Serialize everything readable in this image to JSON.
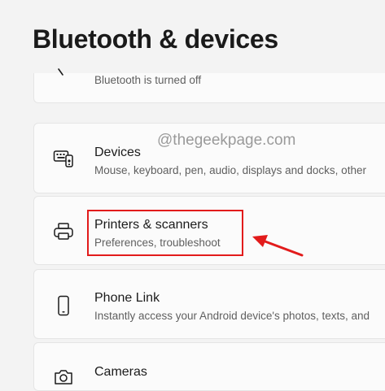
{
  "page": {
    "title": "Bluetooth & devices"
  },
  "watermark": "@thegeekpage.com",
  "items": [
    {
      "id": "bluetooth",
      "title": "",
      "description": "Bluetooth is turned off",
      "icon": "bluetooth-icon"
    },
    {
      "id": "devices",
      "title": "Devices",
      "description": "Mouse, keyboard, pen, audio, displays and docks, other",
      "icon": "devices-icon"
    },
    {
      "id": "printers",
      "title": "Printers & scanners",
      "description": "Preferences, troubleshoot",
      "icon": "printer-icon"
    },
    {
      "id": "phone",
      "title": "Phone Link",
      "description": "Instantly access your Android device's photos, texts, and",
      "icon": "phone-icon"
    },
    {
      "id": "cameras",
      "title": "Cameras",
      "description": "",
      "icon": "camera-icon"
    }
  ],
  "annotation": {
    "highlight_color": "#e21b1b"
  }
}
